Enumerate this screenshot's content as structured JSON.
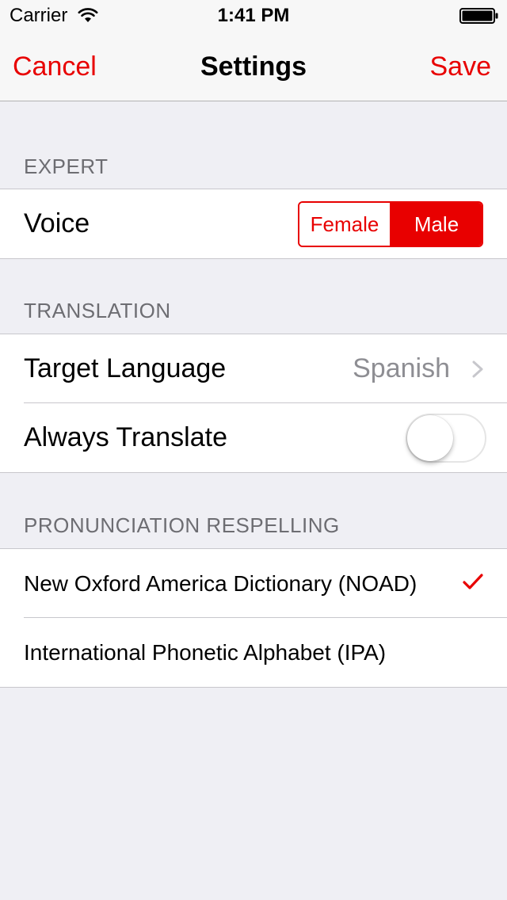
{
  "status_bar": {
    "carrier": "Carrier",
    "time": "1:41 PM",
    "wifi_icon": "wifi-icon",
    "battery_icon": "battery-full-icon"
  },
  "nav": {
    "cancel_label": "Cancel",
    "title": "Settings",
    "save_label": "Save"
  },
  "sections": {
    "expert": {
      "header": "EXPERT",
      "voice": {
        "label": "Voice",
        "options": [
          "Female",
          "Male"
        ],
        "selected": "Male"
      }
    },
    "translation": {
      "header": "TRANSLATION",
      "target_language": {
        "label": "Target Language",
        "value": "Spanish",
        "chevron_icon": "chevron-right-icon"
      },
      "always_translate": {
        "label": "Always Translate",
        "on": false
      }
    },
    "pronunciation": {
      "header": "PRONUNCIATION RESPELLING",
      "options": [
        {
          "label": "New Oxford America Dictionary (NOAD)",
          "checked": true
        },
        {
          "label": "International Phonetic Alphabet (IPA)",
          "checked": false
        }
      ],
      "check_icon": "checkmark-icon"
    }
  },
  "colors": {
    "accent": "#e80000",
    "background": "#efeff4",
    "secondary_text": "#8e8e93",
    "section_header": "#6d6d72"
  }
}
